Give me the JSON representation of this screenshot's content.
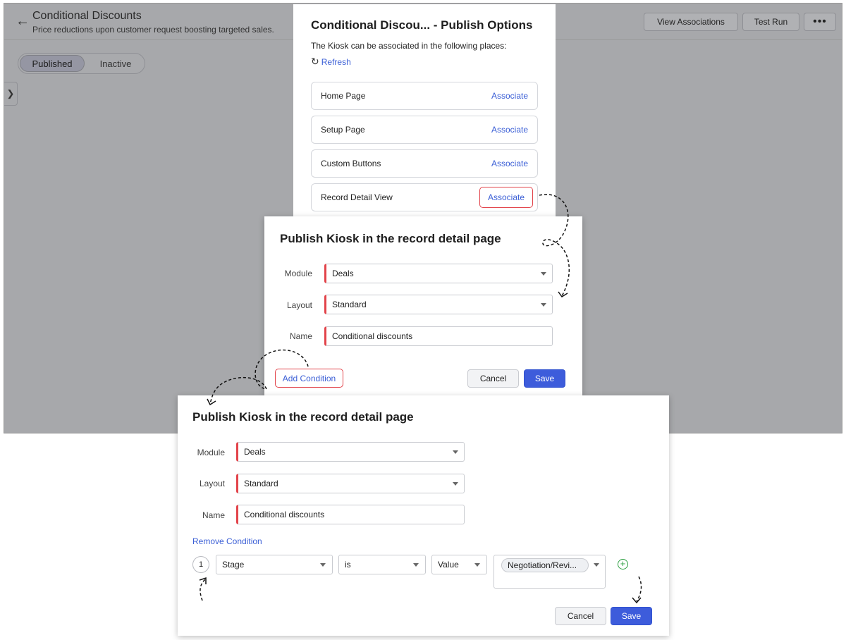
{
  "app": {
    "title": "Conditional Discounts",
    "subtitle": "Price reductions upon customer request boosting targeted sales.",
    "buttons": {
      "view_associations": "View Associations",
      "test_run": "Test Run",
      "more": "•••"
    },
    "toggle": {
      "published": "Published",
      "inactive": "Inactive"
    }
  },
  "publish_options": {
    "title": "Conditional Discou... - Publish Options",
    "description": "The Kiosk can be associated in the following places:",
    "refresh": "Refresh",
    "rows": [
      {
        "label": "Home Page",
        "action": "Associate"
      },
      {
        "label": "Setup Page",
        "action": "Associate"
      },
      {
        "label": "Custom Buttons",
        "action": "Associate"
      },
      {
        "label": "Record Detail View",
        "action": "Associate"
      }
    ]
  },
  "dialog1": {
    "title": "Publish Kiosk in the record detail page",
    "module_label": "Module",
    "module_value": "Deals",
    "layout_label": "Layout",
    "layout_value": "Standard",
    "name_label": "Name",
    "name_value": "Conditional discounts",
    "add_condition": "Add Condition",
    "cancel": "Cancel",
    "save": "Save"
  },
  "dialog2": {
    "title": "Publish Kiosk in the record detail page",
    "module_label": "Module",
    "module_value": "Deals",
    "layout_label": "Layout",
    "layout_value": "Standard",
    "name_label": "Name",
    "name_value": "Conditional discounts",
    "remove_condition": "Remove Condition",
    "condition": {
      "number": "1",
      "field": "Stage",
      "operator": "is",
      "type": "Value",
      "value_chip": "Negotiation/Revi..."
    },
    "cancel": "Cancel",
    "save": "Save"
  },
  "colors": {
    "accent": "#3d5cdb",
    "highlight": "#e2434a",
    "link": "#3b5fd6",
    "add_icon": "#2ea043"
  }
}
